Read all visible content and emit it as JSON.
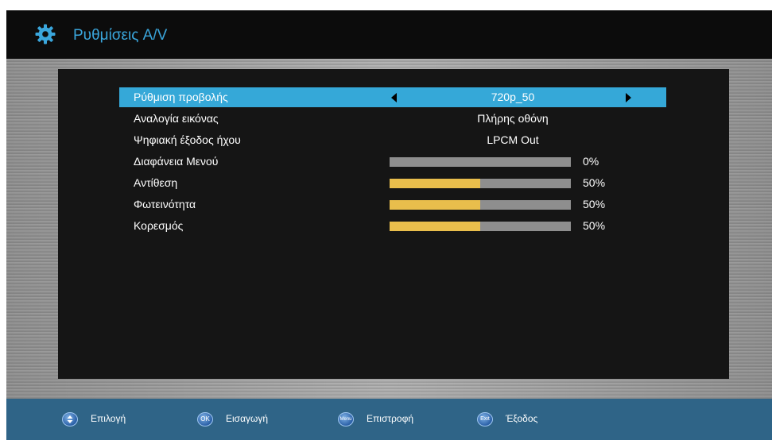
{
  "header": {
    "title": "Ρυθμίσεις A/V",
    "icon": "gear-icon"
  },
  "settings": [
    {
      "label": "Ρύθμιση προβολής",
      "value": "720p_50",
      "selected": true
    },
    {
      "label": "Αναλογία εικόνας",
      "value": "Πλήρης οθόνη"
    },
    {
      "label": "Ψηφιακή έξοδος ήχου",
      "value": "LPCM Out"
    },
    {
      "label": "Διαφάνεια Μενού",
      "level": 0,
      "percent": "0%"
    },
    {
      "label": "Αντίθεση",
      "level": 50,
      "percent": "50%"
    },
    {
      "label": "Φωτεινότητα",
      "level": 50,
      "percent": "50%"
    },
    {
      "label": "Κορεσμός",
      "level": 50,
      "percent": "50%"
    }
  ],
  "footer": {
    "hints": [
      {
        "icon_text": "",
        "label": "Επιλογή",
        "icon": "up-down-icon"
      },
      {
        "icon_text": "OK",
        "label": "Εισαγωγή",
        "icon": "ok-button-icon"
      },
      {
        "icon_text": "Menu",
        "label": "Επιστροφή",
        "icon": "menu-button-icon"
      },
      {
        "icon_text": "Exit",
        "label": "Έξοδος",
        "icon": "exit-button-icon"
      }
    ]
  },
  "colors": {
    "accent": "#35a8d8",
    "title": "#3aa6dc",
    "bar_fill": "#e9be4c",
    "bar_track": "#8e8e8e",
    "footer": "#2f6487"
  }
}
